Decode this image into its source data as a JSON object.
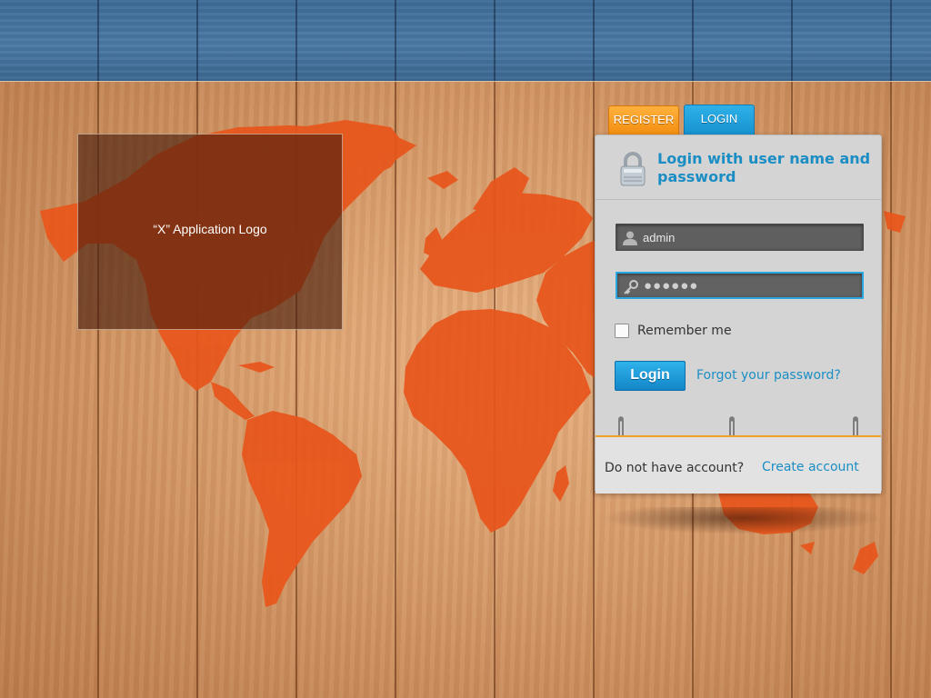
{
  "logo": {
    "text": "“X” Application Logo"
  },
  "tabs": [
    {
      "label": "REGISTER",
      "color": "#f29216"
    },
    {
      "label": "LOGIN",
      "color": "#1c9bd8"
    }
  ],
  "login_panel": {
    "title": "Login with user name and password",
    "username": {
      "value": "admin",
      "icon": "user-icon"
    },
    "password": {
      "value": "●●●●●●",
      "icon": "key-icon"
    },
    "remember_label": "Remember me",
    "remember_checked": false,
    "login_button": "Login",
    "forgot_link": "Forgot your password?",
    "no_account_text": "Do not have account?",
    "create_account_link": "Create account"
  },
  "colors": {
    "accent": "#1a8ec4",
    "map": "#e8561c",
    "footer_rule": "#f0a022"
  }
}
